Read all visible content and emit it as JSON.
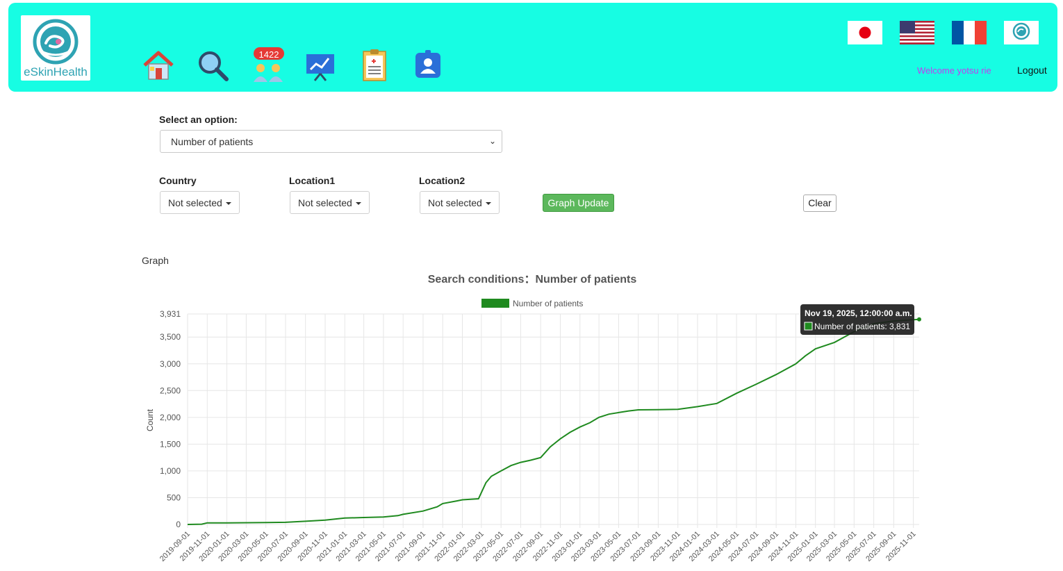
{
  "header": {
    "logo_text": "eSkinHealth",
    "badge_count": "1422",
    "welcome": "Welcome yotsu rie",
    "logout": "Logout",
    "nav_icons": [
      "home-icon",
      "search-icon",
      "patients-icon",
      "analytics-icon",
      "clipboard-icon",
      "user-profile-icon"
    ],
    "flags": [
      "japan-flag-icon",
      "usa-flag-icon",
      "france-flag-icon",
      "eskinhealth-icon"
    ],
    "brand_color": "#17fde3"
  },
  "filters": {
    "select_label": "Select an option:",
    "select_value": "Number of patients",
    "country_label": "Country",
    "country_value": "Not selected",
    "location1_label": "Location1",
    "location1_value": "Not selected",
    "location2_label": "Location2",
    "location2_value": "Not selected",
    "update_button": "Graph Update",
    "clear_button": "Clear"
  },
  "graph_label": "Graph",
  "chart_data": {
    "type": "line",
    "title": "Search conditions：Number of patients",
    "ylabel": "Count",
    "xlabel": "",
    "legend": "top",
    "grid": true,
    "series": [
      {
        "name": "Number of patients",
        "color": "#1f8a1f",
        "points": [
          [
            "2019-09-01",
            0
          ],
          [
            "2019-10-15",
            5
          ],
          [
            "2019-11-01",
            30
          ],
          [
            "2020-01-01",
            30
          ],
          [
            "2020-05-01",
            35
          ],
          [
            "2020-07-01",
            40
          ],
          [
            "2020-09-01",
            60
          ],
          [
            "2020-11-01",
            80
          ],
          [
            "2021-01-01",
            120
          ],
          [
            "2021-03-01",
            130
          ],
          [
            "2021-05-01",
            140
          ],
          [
            "2021-06-15",
            165
          ],
          [
            "2021-07-01",
            190
          ],
          [
            "2021-09-01",
            250
          ],
          [
            "2021-10-15",
            330
          ],
          [
            "2021-11-01",
            390
          ],
          [
            "2021-12-15",
            440
          ],
          [
            "2022-01-01",
            460
          ],
          [
            "2022-02-20",
            480
          ],
          [
            "2022-03-15",
            780
          ],
          [
            "2022-04-01",
            900
          ],
          [
            "2022-05-01",
            1000
          ],
          [
            "2022-06-01",
            1100
          ],
          [
            "2022-07-01",
            1160
          ],
          [
            "2022-08-01",
            1200
          ],
          [
            "2022-09-01",
            1250
          ],
          [
            "2022-10-01",
            1450
          ],
          [
            "2022-11-01",
            1600
          ],
          [
            "2022-12-01",
            1720
          ],
          [
            "2023-01-01",
            1820
          ],
          [
            "2023-02-01",
            1900
          ],
          [
            "2023-03-01",
            2000
          ],
          [
            "2023-04-01",
            2060
          ],
          [
            "2023-05-01",
            2090
          ],
          [
            "2023-06-01",
            2120
          ],
          [
            "2023-07-01",
            2140
          ],
          [
            "2023-09-01",
            2145
          ],
          [
            "2023-11-01",
            2150
          ],
          [
            "2024-01-01",
            2200
          ],
          [
            "2024-03-01",
            2260
          ],
          [
            "2024-05-01",
            2450
          ],
          [
            "2024-07-01",
            2620
          ],
          [
            "2024-09-01",
            2800
          ],
          [
            "2024-11-01",
            3000
          ],
          [
            "2024-12-01",
            3150
          ],
          [
            "2025-01-01",
            3280
          ],
          [
            "2025-03-01",
            3400
          ],
          [
            "2025-05-01",
            3600
          ],
          [
            "2025-07-01",
            3750
          ],
          [
            "2025-09-01",
            3800
          ],
          [
            "2025-11-19",
            3831
          ]
        ]
      }
    ],
    "ylim": [
      0,
      3931
    ],
    "yticks": [
      0,
      500,
      1000,
      1500,
      2000,
      2500,
      3000,
      3500,
      3931
    ],
    "ytick_labels": [
      "0",
      "500",
      "1,000",
      "1,500",
      "2,000",
      "2,500",
      "3,000",
      "3,500",
      "3,931"
    ],
    "xlim": [
      "2019-09-01",
      "2025-11-19"
    ],
    "xticks": [
      "2019-09-01",
      "2019-11-01",
      "2020-01-01",
      "2020-03-01",
      "2020-05-01",
      "2020-07-01",
      "2020-09-01",
      "2020-11-01",
      "2021-01-01",
      "2021-03-01",
      "2021-05-01",
      "2021-07-01",
      "2021-09-01",
      "2021-11-01",
      "2022-01-01",
      "2022-03-01",
      "2022-05-01",
      "2022-07-01",
      "2022-09-01",
      "2022-11-01",
      "2023-01-01",
      "2023-03-01",
      "2023-05-01",
      "2023-07-01",
      "2023-09-01",
      "2023-11-01",
      "2024-01-01",
      "2024-03-01",
      "2024-05-01",
      "2024-07-01",
      "2024-09-01",
      "2024-11-01",
      "2025-01-01",
      "2025-03-01",
      "2025-05-01",
      "2025-07-01",
      "2025-09-01",
      "2025-11-01"
    ],
    "tooltip": {
      "title": "Nov 19, 2025, 12:00:00 a.m.",
      "text": "Number of patients: 3,831"
    }
  }
}
